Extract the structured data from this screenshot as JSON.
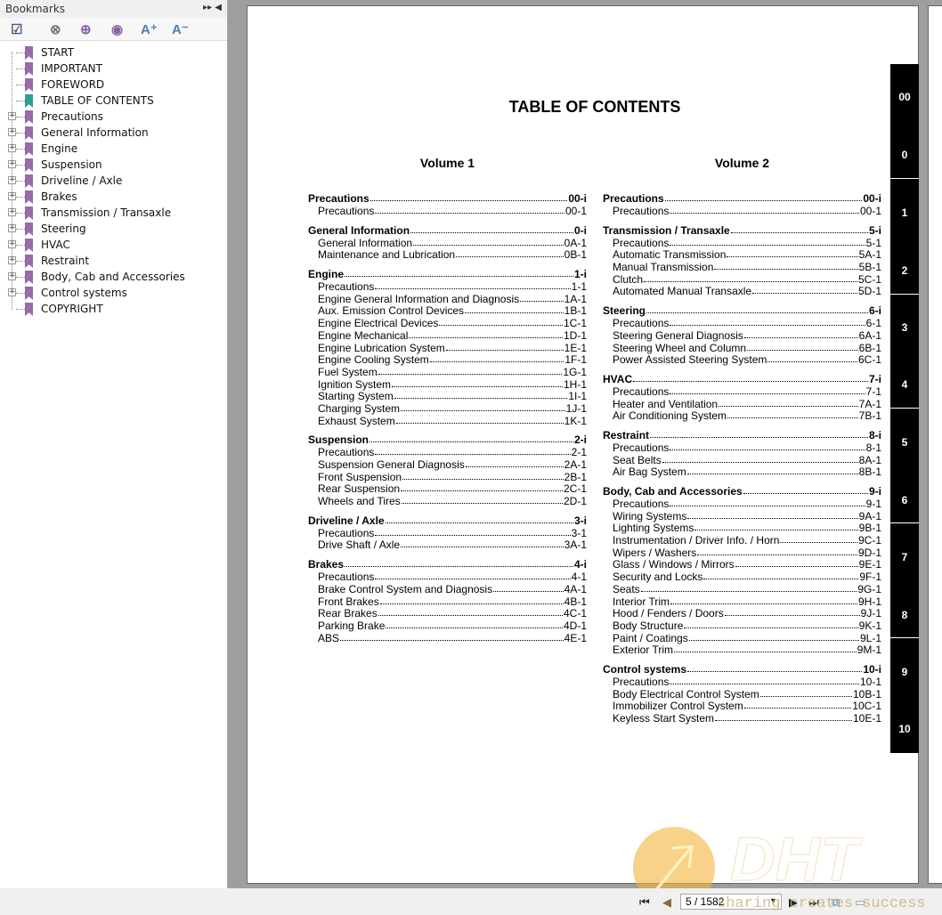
{
  "bookmarks": {
    "title": "Bookmarks",
    "items": [
      {
        "label": "START",
        "expandable": false,
        "color": "#9b6aa8"
      },
      {
        "label": "IMPORTANT",
        "expandable": false,
        "color": "#9b6aa8"
      },
      {
        "label": "FOREWORD",
        "expandable": false,
        "color": "#9b6aa8"
      },
      {
        "label": "TABLE OF CONTENTS",
        "expandable": false,
        "color": "#2f9e8f"
      },
      {
        "label": "Precautions",
        "expandable": true
      },
      {
        "label": "General Information",
        "expandable": true
      },
      {
        "label": "Engine",
        "expandable": true
      },
      {
        "label": "Suspension",
        "expandable": true
      },
      {
        "label": "Driveline / Axle",
        "expandable": true
      },
      {
        "label": "Brakes",
        "expandable": true
      },
      {
        "label": "Transmission / Transaxle",
        "expandable": true
      },
      {
        "label": "Steering",
        "expandable": true
      },
      {
        "label": "HVAC",
        "expandable": true
      },
      {
        "label": "Restraint",
        "expandable": true
      },
      {
        "label": "Body, Cab and Accessories",
        "expandable": true
      },
      {
        "label": "Control systems",
        "expandable": true
      },
      {
        "label": "COPYRIGHT",
        "expandable": false
      }
    ]
  },
  "toc": {
    "title": "TABLE OF CONTENTS",
    "volumes": [
      {
        "title": "Volume 1",
        "sections": [
          {
            "name": "Precautions",
            "page": "00-i",
            "items": [
              [
                "Precautions",
                "00-1"
              ]
            ]
          },
          {
            "name": "General Information",
            "page": "0-i",
            "items": [
              [
                "General Information",
                "0A-1"
              ],
              [
                "Maintenance and Lubrication",
                "0B-1"
              ]
            ]
          },
          {
            "name": "Engine",
            "page": "1-i",
            "items": [
              [
                "Precautions",
                "1-1"
              ],
              [
                "Engine General Information and Diagnosis",
                "1A-1"
              ],
              [
                "Aux. Emission Control Devices",
                "1B-1"
              ],
              [
                "Engine Electrical Devices",
                "1C-1"
              ],
              [
                "Engine Mechanical",
                "1D-1"
              ],
              [
                "Engine Lubrication System",
                "1E-1"
              ],
              [
                "Engine Cooling System",
                "1F-1"
              ],
              [
                "Fuel System",
                "1G-1"
              ],
              [
                "Ignition System",
                "1H-1"
              ],
              [
                "Starting System",
                "1I-1"
              ],
              [
                "Charging System",
                "1J-1"
              ],
              [
                "Exhaust System",
                "1K-1"
              ]
            ]
          },
          {
            "name": "Suspension",
            "page": "2-i",
            "items": [
              [
                "Precautions",
                "2-1"
              ],
              [
                "Suspension General Diagnosis",
                "2A-1"
              ],
              [
                "Front Suspension",
                "2B-1"
              ],
              [
                "Rear Suspension",
                "2C-1"
              ],
              [
                "Wheels and Tires",
                "2D-1"
              ]
            ]
          },
          {
            "name": "Driveline / Axle",
            "page": "3-i",
            "items": [
              [
                "Precautions",
                "3-1"
              ],
              [
                "Drive Shaft / Axle",
                "3A-1"
              ]
            ]
          },
          {
            "name": "Brakes",
            "page": "4-i",
            "items": [
              [
                "Precautions",
                "4-1"
              ],
              [
                "Brake Control System and Diagnosis",
                "4A-1"
              ],
              [
                "Front Brakes",
                "4B-1"
              ],
              [
                "Rear Brakes",
                "4C-1"
              ],
              [
                "Parking Brake",
                "4D-1"
              ],
              [
                "ABS",
                "4E-1"
              ]
            ]
          }
        ]
      },
      {
        "title": "Volume 2",
        "sections": [
          {
            "name": "Precautions",
            "page": "00-i",
            "items": [
              [
                "Precautions",
                "00-1"
              ]
            ]
          },
          {
            "name": "Transmission / Transaxle",
            "page": "5-i",
            "items": [
              [
                "Precautions",
                "5-1"
              ],
              [
                "Automatic Transmission",
                "5A-1"
              ],
              [
                "Manual Transmission",
                "5B-1"
              ],
              [
                "Clutch",
                "5C-1"
              ],
              [
                "Automated Manual Transaxle",
                "5D-1"
              ]
            ]
          },
          {
            "name": "Steering",
            "page": "6-i",
            "items": [
              [
                "Precautions",
                "6-1"
              ],
              [
                "Steering General Diagnosis",
                "6A-1"
              ],
              [
                "Steering Wheel and Column",
                "6B-1"
              ],
              [
                "Power Assisted Steering System",
                "6C-1"
              ]
            ]
          },
          {
            "name": "HVAC",
            "page": "7-i",
            "items": [
              [
                "Precautions",
                "7-1"
              ],
              [
                "Heater and Ventilation",
                "7A-1"
              ],
              [
                "Air Conditioning System",
                "7B-1"
              ]
            ]
          },
          {
            "name": "Restraint",
            "page": "8-i",
            "items": [
              [
                "Precautions",
                "8-1"
              ],
              [
                "Seat Belts",
                "8A-1"
              ],
              [
                "Air Bag System",
                "8B-1"
              ]
            ]
          },
          {
            "name": "Body, Cab and Accessories",
            "page": "9-i",
            "items": [
              [
                "Precautions",
                "9-1"
              ],
              [
                "Wiring Systems",
                "9A-1"
              ],
              [
                "Lighting Systems",
                "9B-1"
              ],
              [
                "Instrumentation / Driver Info. / Horn",
                "9C-1"
              ],
              [
                "Wipers / Washers",
                "9D-1"
              ],
              [
                "Glass / Windows / Mirrors",
                "9E-1"
              ],
              [
                "Security and Locks",
                "9F-1"
              ],
              [
                "Seats",
                "9G-1"
              ],
              [
                "Interior Trim",
                "9H-1"
              ],
              [
                "Hood / Fenders / Doors",
                "9J-1"
              ],
              [
                "Body Structure",
                "9K-1"
              ],
              [
                "Paint / Coatings",
                "9L-1"
              ],
              [
                "Exterior Trim",
                "9M-1"
              ]
            ]
          },
          {
            "name": "Control systems",
            "page": "10-i",
            "items": [
              [
                "Precautions",
                "10-1"
              ],
              [
                "Body Electrical Control System",
                "10B-1"
              ],
              [
                "Immobilizer Control System",
                "10C-1"
              ],
              [
                "Keyless Start System",
                "10E-1"
              ]
            ]
          }
        ]
      }
    ],
    "tabs": [
      "00",
      "0",
      "1",
      "2",
      "3",
      "4",
      "5",
      "6",
      "7",
      "8",
      "9",
      "10"
    ]
  },
  "navigation": {
    "page_value": "5 / 1582"
  },
  "watermark": {
    "text": "sharing creates success",
    "logo": "DHT"
  }
}
